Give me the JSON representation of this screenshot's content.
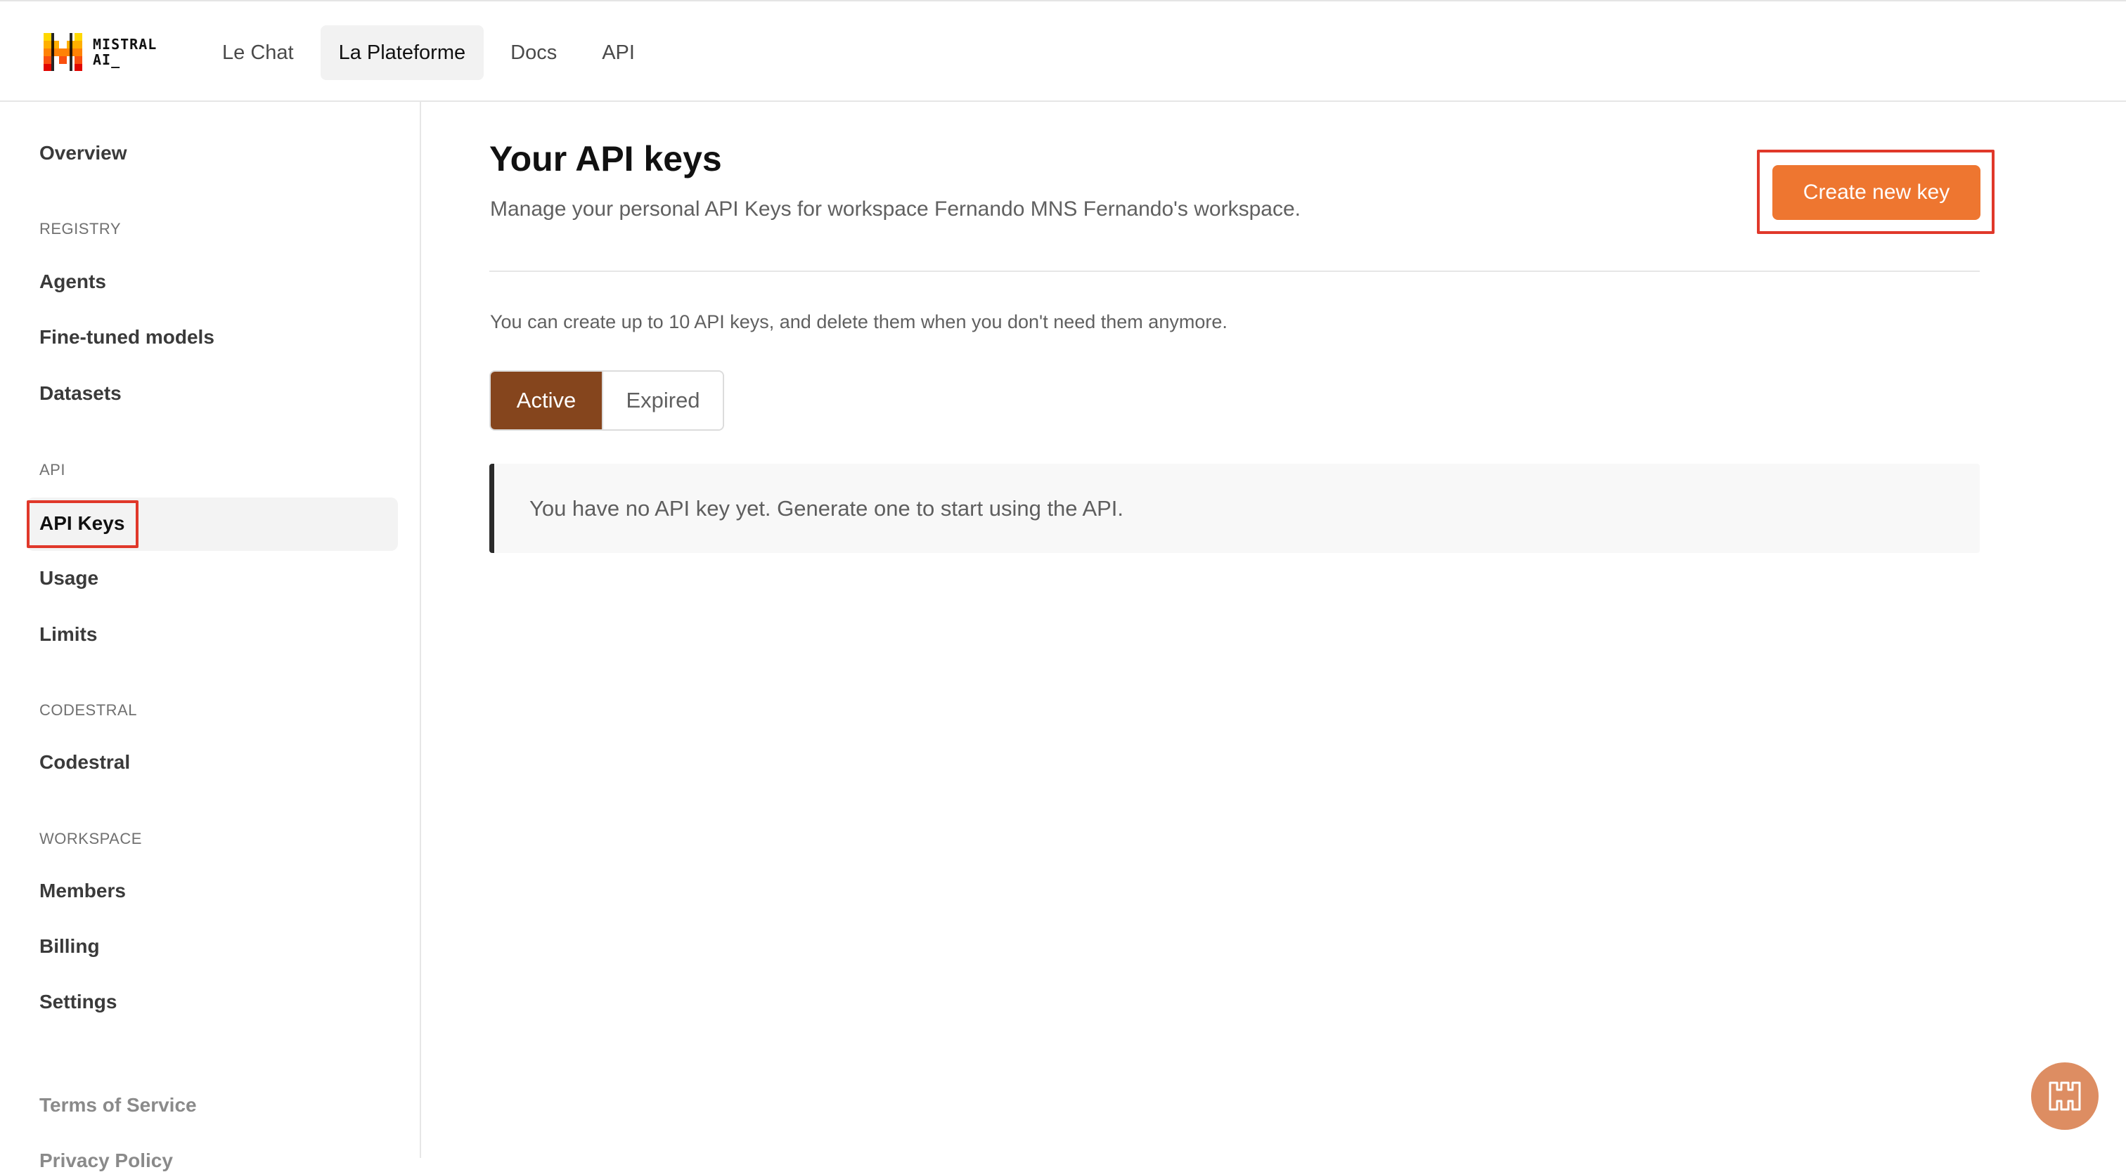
{
  "brand": {
    "line1": "MISTRAL",
    "line2": "AI_",
    "colors": [
      "#ffd800",
      "#ffaf00",
      "#ff8205",
      "#fa500f",
      "#e10500"
    ]
  },
  "nav": {
    "items": [
      {
        "label": "Le Chat",
        "active": false
      },
      {
        "label": "La Plateforme",
        "active": true
      },
      {
        "label": "Docs",
        "active": false
      },
      {
        "label": "API",
        "active": false
      }
    ]
  },
  "sidebar": {
    "overview": "Overview",
    "registry": {
      "heading": "REGISTRY",
      "items": [
        "Agents",
        "Fine-tuned models",
        "Datasets"
      ]
    },
    "api": {
      "heading": "API",
      "items": [
        "API Keys",
        "Usage",
        "Limits"
      ],
      "active": "API Keys"
    },
    "codestral": {
      "heading": "CODESTRAL",
      "items": [
        "Codestral"
      ]
    },
    "workspace": {
      "heading": "WORKSPACE",
      "items": [
        "Members",
        "Billing",
        "Settings"
      ]
    },
    "footer": [
      "Terms of Service",
      "Privacy Policy"
    ]
  },
  "main": {
    "title": "Your API keys",
    "subtitle": "Manage your personal API Keys for workspace Fernando MNS Fernando's workspace.",
    "create_button": "Create new key",
    "info": "You can create up to 10 API keys, and delete them when you don't need them anymore.",
    "tabs": [
      {
        "label": "Active",
        "selected": true
      },
      {
        "label": "Expired",
        "selected": false
      }
    ],
    "empty_message": "You have no API key yet. Generate one to start using the API."
  },
  "colors": {
    "accent_orange": "#ee7630",
    "active_tab": "#85451d",
    "highlight_red": "#e0382a",
    "fab": "#dd8d62"
  },
  "icons": {
    "logo": "mistral-logo-icon",
    "help": "mistral-help-icon"
  }
}
